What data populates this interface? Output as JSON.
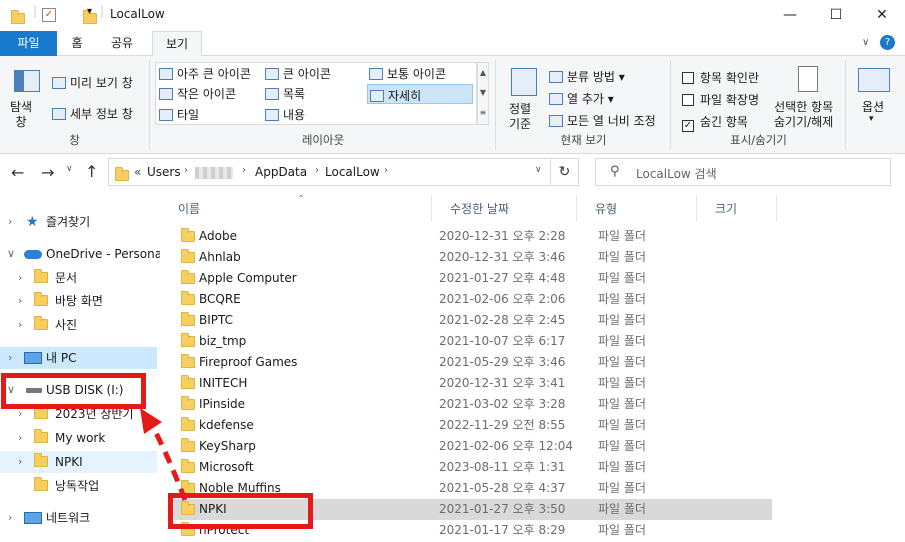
{
  "window": {
    "title": "LocalLow"
  },
  "ribbon_tabs": [
    "파일",
    "홈",
    "공유",
    "보기"
  ],
  "ribbon": {
    "pane": {
      "nav_pane": "탐색\n창",
      "preview": "미리 보기 창",
      "details": "세부 정보 창",
      "group_label": "창"
    },
    "layout": {
      "items": [
        "아주 큰 아이콘",
        "큰 아이콘",
        "보통 아이콘",
        "작은 아이콘",
        "목록",
        "자세히",
        "타일",
        "내용"
      ],
      "selected": "자세히",
      "group_label": "레이아웃"
    },
    "current_view": {
      "sort": "정렬\n기준",
      "group_by": "분류 방법",
      "add_columns": "열 추가",
      "fit_columns": "모든 열 너비 조정",
      "group_label": "현재 보기"
    },
    "show_hide": {
      "item_check": "항목 확인란",
      "extensions": "파일 확장명",
      "hidden_items": "숨긴 항목",
      "hide_selected": "선택한 항목\n숨기기/해제",
      "group_label": "표시/숨기기"
    },
    "options": {
      "label": "옵션"
    }
  },
  "address": {
    "crumbs": [
      "Users",
      "AppData",
      "LocalLow"
    ],
    "prefix": "«"
  },
  "search": {
    "placeholder": "LocalLow 검색"
  },
  "sidebar": [
    {
      "label": "즐겨찾기",
      "icon": "star-icon"
    },
    {
      "label": "OneDrive - Personal",
      "icon": "cloud-icon"
    },
    {
      "label": "문서",
      "icon": "folder-icon"
    },
    {
      "label": "바탕 화면",
      "icon": "folder-icon"
    },
    {
      "label": "사진",
      "icon": "folder-icon"
    },
    {
      "label": "내 PC",
      "icon": "pc-icon"
    },
    {
      "label": "USB DISK (I:)",
      "icon": "usb-drive-icon"
    },
    {
      "label": "2023년 상반기",
      "icon": "folder-icon"
    },
    {
      "label": "My work",
      "icon": "folder-icon"
    },
    {
      "label": "NPKI",
      "icon": "folder-icon"
    },
    {
      "label": "낭독작업",
      "icon": "folder-icon"
    },
    {
      "label": "네트워크",
      "icon": "network-icon"
    }
  ],
  "columns": [
    "이름",
    "수정한 날짜",
    "유형",
    "크기"
  ],
  "files": [
    {
      "name": "Adobe",
      "date": "2020-12-31 오후 2:28",
      "type": "파일 폴더"
    },
    {
      "name": "Ahnlab",
      "date": "2020-12-31 오후 3:46",
      "type": "파일 폴더"
    },
    {
      "name": "Apple Computer",
      "date": "2021-01-27 오후 4:48",
      "type": "파일 폴더"
    },
    {
      "name": "BCQRE",
      "date": "2021-02-06 오후 2:06",
      "type": "파일 폴더"
    },
    {
      "name": "BIPTC",
      "date": "2021-02-28 오후 2:45",
      "type": "파일 폴더"
    },
    {
      "name": "biz_tmp",
      "date": "2021-10-07 오후 6:17",
      "type": "파일 폴더"
    },
    {
      "name": "Fireproof Games",
      "date": "2021-05-29 오후 3:46",
      "type": "파일 폴더"
    },
    {
      "name": "INITECH",
      "date": "2020-12-31 오후 3:41",
      "type": "파일 폴더"
    },
    {
      "name": "IPinside",
      "date": "2021-03-02 오후 3:28",
      "type": "파일 폴더"
    },
    {
      "name": "kdefense",
      "date": "2022-11-29 오전 8:55",
      "type": "파일 폴더"
    },
    {
      "name": "KeySharp",
      "date": "2021-02-06 오후 12:04",
      "type": "파일 폴더"
    },
    {
      "name": "Microsoft",
      "date": "2023-08-11 오후 1:31",
      "type": "파일 폴더"
    },
    {
      "name": "Noble Muffins",
      "date": "2021-05-28 오후 4:37",
      "type": "파일 폴더"
    },
    {
      "name": "NPKI",
      "date": "2021-01-27 오후 3:50",
      "type": "파일 폴더"
    },
    {
      "name": "nProtect",
      "date": "2021-01-17 오후 8:29",
      "type": "파일 폴더"
    }
  ],
  "colors": {
    "accent": "#1979ca",
    "annotation": "#e61919",
    "selection": "#d9d9d9"
  }
}
